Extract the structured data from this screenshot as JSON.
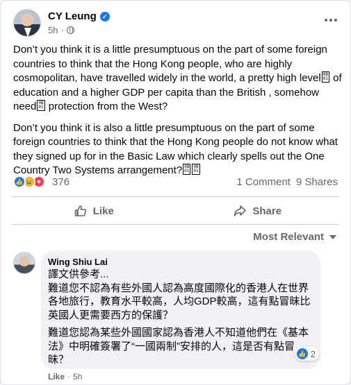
{
  "post": {
    "author": "CY Leung",
    "time": "5h",
    "paragraph1_a": "Don’t you think it is a little presumptuous on the part of some foreign countries to think that the Hong Kong people, who are highly cosmopolitan, have travelled widely in the world, a pretty high level",
    "paragraph1_b": " of education and a higher GDP per capita than the British , somehow need",
    "paragraph1_c": " protection from the West?",
    "paragraph2": "Don’t you think it is also a little presumptuous on the part of some foreign countries to think that the Hong Kong people do not know what they signed up for in the Basic Law which clearly spells out the One Country Two Systems arrangement?",
    "tofu_glyph": "0B\n01",
    "reaction_count": "376",
    "comments": "1 Comment",
    "shares": "9 Shares"
  },
  "actions": {
    "like": "Like",
    "share": "Share"
  },
  "sort": {
    "label": "Most Relevant"
  },
  "comment": {
    "author": "Wing Shiu Lai",
    "line1": "譯文供參考...",
    "para1": "難道您不認為有些外國人認為高度國際化的香港人在世界各地旅行，教育水平較高，人均GDP較高，這有點冒昧比英國人更需要西方的保護？",
    "para2": "難道您認為某些外國國家認為香港人不知道他們在《基本法》中明確簽署了“一國兩制”安排的人，這是否有點冒昧？",
    "reaction_count": "2",
    "like": "Like",
    "dot": "·",
    "time": "5h"
  },
  "colors": {
    "accent": "#1877f2",
    "secondary_text": "#65676b",
    "love": "#f33e58",
    "haha": "#f7b125"
  },
  "icons": [
    "verified-badge-icon",
    "globe-icon",
    "more-icon",
    "like-icon",
    "share-icon",
    "chevron-down-icon"
  ]
}
